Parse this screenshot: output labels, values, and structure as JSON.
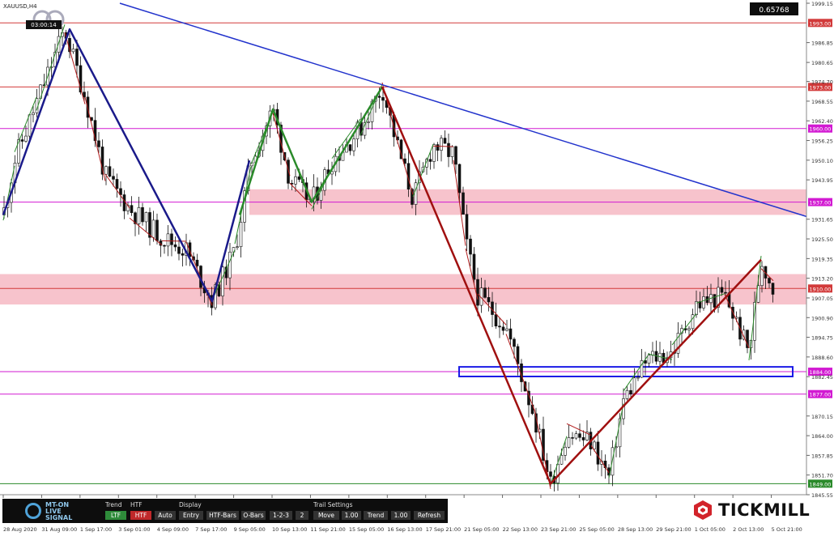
{
  "symbol_label": "XAUUSD,H4",
  "timer": "03:00:14",
  "value_box": "0.65768",
  "chart_data": {
    "type": "candlestick",
    "ylim": [
      1845.55,
      1999.15
    ],
    "grid": false,
    "y_ticks": [
      1999.15,
      1986.85,
      1980.65,
      1974.7,
      1968.55,
      1962.4,
      1956.25,
      1950.1,
      1943.95,
      1931.65,
      1925.5,
      1919.35,
      1913.2,
      1907.05,
      1900.9,
      1894.75,
      1888.6,
      1882.45,
      1870.15,
      1864.0,
      1857.85,
      1851.7,
      1845.55
    ],
    "x_ticks": [
      "28 Aug 2020",
      "31 Aug 09:00",
      "1 Sep 17:00",
      "3 Sep 01:00",
      "4 Sep 09:00",
      "7 Sep 17:00",
      "9 Sep 05:00",
      "10 Sep 13:00",
      "11 Sep 21:00",
      "15 Sep 05:00",
      "16 Sep 13:00",
      "17 Sep 21:00",
      "21 Sep 05:00",
      "22 Sep 13:00",
      "23 Sep 21:00",
      "25 Sep 05:00",
      "28 Sep 13:00",
      "29 Sep 21:00",
      "1 Oct 05:00",
      "2 Oct 13:00",
      "5 Oct 21:00"
    ],
    "levels": [
      {
        "label": "1993.00",
        "value": 1993.0,
        "color": "#d23a3a"
      },
      {
        "label": "1973.00",
        "value": 1973.0,
        "color": "#d23a3a"
      },
      {
        "label": "1960.00",
        "value": 1960.0,
        "color": "#d21ad2"
      },
      {
        "label": "1937.00",
        "value": 1937.0,
        "color": "#d21ad2"
      },
      {
        "label": "1910.00",
        "value": 1910.0,
        "color": "#d23a3a"
      },
      {
        "label": "1884.00",
        "value": 1884.0,
        "color": "#d21ad2"
      },
      {
        "label": "1877.00",
        "value": 1877.0,
        "color": "#d21ad2"
      },
      {
        "label": "1849.00",
        "value": 1849.0,
        "color": "#2a8a2a"
      }
    ],
    "zones": [
      {
        "from": 1933.0,
        "to": 1941.0,
        "color": "#f7c3cc"
      },
      {
        "from": 1905.0,
        "to": 1914.5,
        "color": "#f7c3cc"
      }
    ],
    "support_box": {
      "from": 1882.5,
      "to": 1885.5,
      "color": "#1a1ae6"
    },
    "trendline_price": [
      1999.15,
      1932.5
    ],
    "zigzag_dark": [
      1933,
      1991,
      1906,
      1950
    ],
    "zigzag_green": [
      1933,
      1966,
      1937,
      1973
    ],
    "zigzag_red": [
      1973,
      1849,
      1919
    ]
  },
  "toolbar": {
    "logo_line1": "MT-ON",
    "logo_line2": "LIVE",
    "logo_line3": "SIGNAL",
    "trend_label": "Trend",
    "trend_value": "LTF",
    "htf_label": "HTF",
    "htf_value": "HTF",
    "display_label": "Display",
    "display_value": "Auto",
    "entry": "Entry",
    "htf_bars": "HTF-Bars",
    "o_bars": "O-Bars",
    "one_two_three": "1-2-3",
    "two": "2",
    "trail_settings": "Trail Settings",
    "move": "Move",
    "move_value": "1.00",
    "trend2": "Trend",
    "trend2_value": "1.00",
    "refresh": "Refresh"
  },
  "brand": "TICKMILL",
  "colors": {
    "bull_line": "#2a8a2a",
    "bear_line": "#b01a1a",
    "zigzag_dark": "#1a1a8a",
    "zigzag_green": "#2a8a2a",
    "zigzag_red": "#a01010",
    "trendline": "#2233cc",
    "toolbar_bg": "#0d0d0d",
    "brand_red": "#d2232a"
  }
}
